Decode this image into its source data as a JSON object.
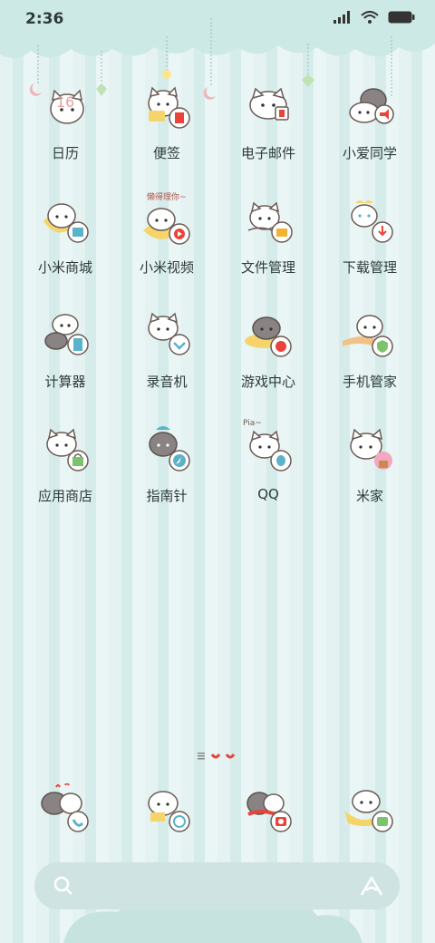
{
  "status_bar": {
    "time": "2:36"
  },
  "apps": [
    {
      "label": "日历",
      "icon": "calendar-icon",
      "badge_text": "16"
    },
    {
      "label": "便签",
      "icon": "notes-icon"
    },
    {
      "label": "电子邮件",
      "icon": "email-icon"
    },
    {
      "label": "小爱同学",
      "icon": "assistant-icon"
    },
    {
      "label": "小米商城",
      "icon": "mall-icon"
    },
    {
      "label": "小米视频",
      "icon": "video-icon",
      "caption": "懒得理你~"
    },
    {
      "label": "文件管理",
      "icon": "file-manager-icon"
    },
    {
      "label": "下载管理",
      "icon": "download-icon"
    },
    {
      "label": "计算器",
      "icon": "calculator-icon"
    },
    {
      "label": "录音机",
      "icon": "recorder-icon"
    },
    {
      "label": "游戏中心",
      "icon": "game-center-icon"
    },
    {
      "label": "手机管家",
      "icon": "security-icon"
    },
    {
      "label": "应用商店",
      "icon": "app-store-icon"
    },
    {
      "label": "指南针",
      "icon": "compass-icon"
    },
    {
      "label": "QQ",
      "icon": "qq-icon",
      "caption": "Pia~"
    },
    {
      "label": "米家",
      "icon": "mijia-icon"
    }
  ],
  "dock": [
    {
      "icon": "phone-icon"
    },
    {
      "icon": "browser-icon"
    },
    {
      "icon": "camera-icon"
    },
    {
      "icon": "messages-icon"
    }
  ],
  "colors": {
    "background": "#e4f3f2",
    "accent_red": "#e8443a",
    "cat_white": "#ffffff",
    "cat_grey": "#8a8383"
  }
}
